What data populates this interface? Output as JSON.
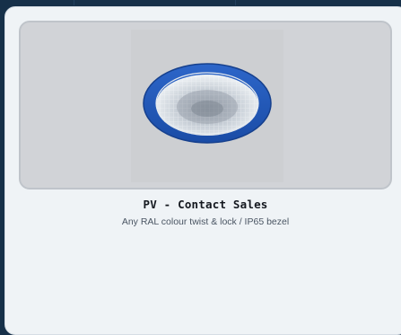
{
  "product": {
    "title": "PV - Contact Sales",
    "subtitle": "Any RAL colour twist & lock / IP65 bezel",
    "image_alt": "blue-ring-downlight",
    "bezel_color": "#1f57b8"
  }
}
